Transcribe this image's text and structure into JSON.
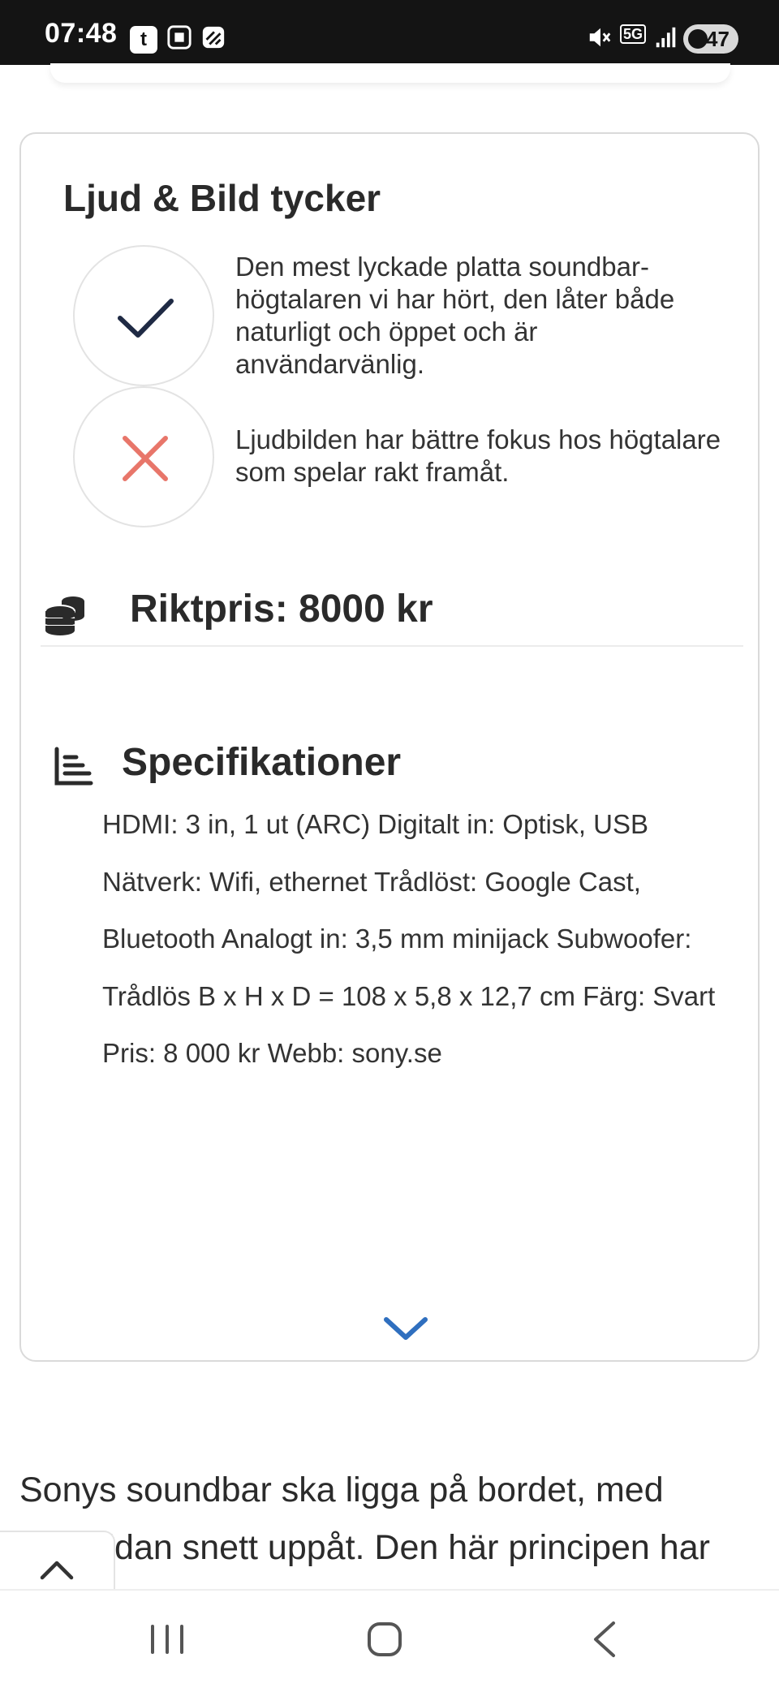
{
  "status_bar": {
    "time": "07:48",
    "network": "5G",
    "battery": "47",
    "icons": [
      "tumblr-icon",
      "screenshot-icon",
      "app-icon",
      "mute-icon",
      "5g-icon",
      "signal-icon",
      "battery-icon"
    ]
  },
  "opinion": {
    "title": "Ljud & Bild tycker",
    "pro": "Den mest lyckade platta soundbar-högtalaren vi har hört, den låter både naturligt och öppet och är användarvänlig.",
    "con": "Ljudbilden har bättre fokus hos högtalare som spelar rakt framåt."
  },
  "price": {
    "text": "Riktpris: 8000 kr"
  },
  "specs": {
    "title": "Specifikationer",
    "lines": [
      "HDMI: 3 in, 1 ut (ARC) Digitalt in: Optisk, USB",
      "Nätverk: Wifi, ethernet Trådlöst: Google Cast,",
      "Bluetooth Analogt in: 3,5 mm minijack Subwoofer:",
      "Trådlös B x H x D = 108 x 5,8 x 12,7 cm Färg: Svart",
      "Pris: 8 000 kr Webb: sony.se"
    ]
  },
  "article": {
    "line1": "Sonys soundbar ska ligga på bordet, med",
    "line2": "framsidan snett uppåt. Den här principen har"
  },
  "colors": {
    "check": "#1f2a44",
    "cross": "#e8766a",
    "accent": "#2f6fbf",
    "statusbar": "#141414"
  }
}
